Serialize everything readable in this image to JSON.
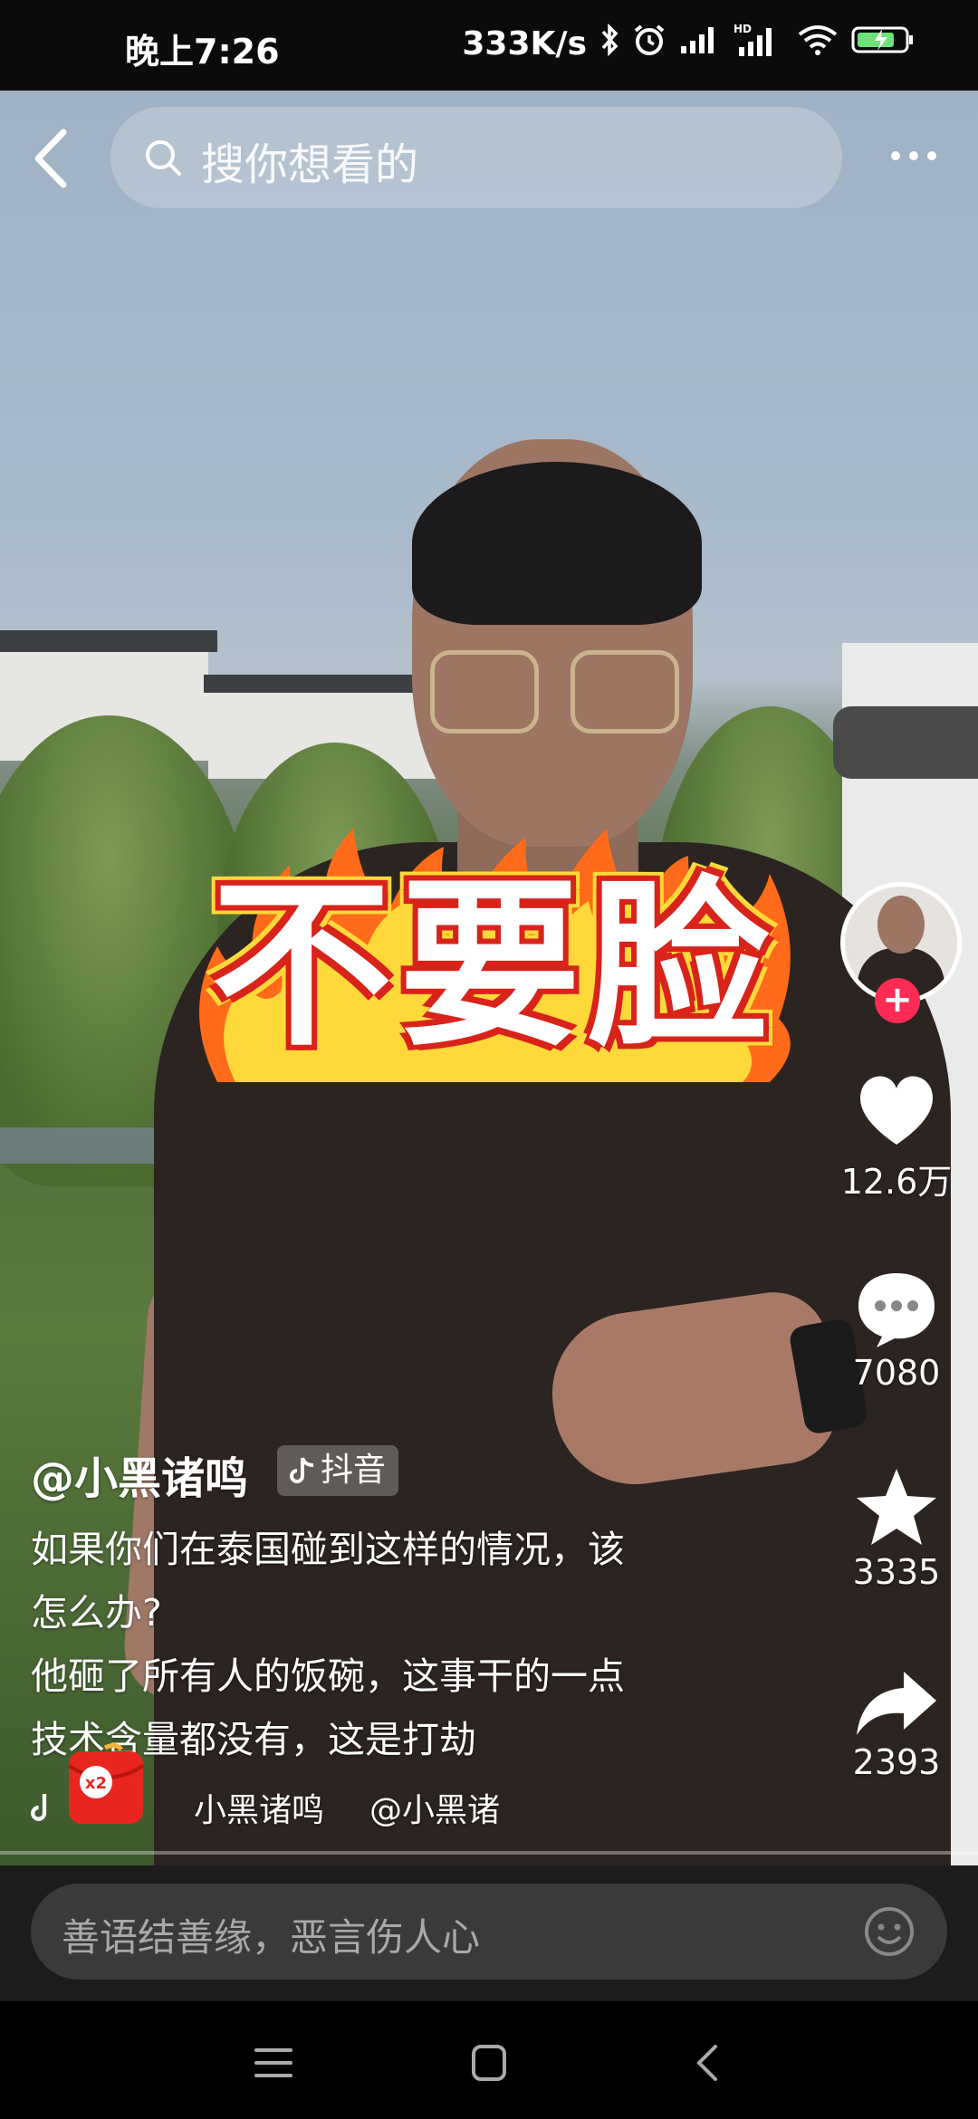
{
  "status_bar": {
    "time": "晚上7:26",
    "network_speed": "333K/s",
    "icons": [
      "bluetooth-icon",
      "alarm-icon",
      "signal-icon",
      "hd-signal-icon",
      "wifi-icon",
      "battery-charging-icon"
    ],
    "hd_label": "HD"
  },
  "top_bar": {
    "search_placeholder": "搜你想看的"
  },
  "video": {
    "sticker_text": "不要脸"
  },
  "sidebar": {
    "likes": "12.6万",
    "comments": "7080",
    "favorites": "3335",
    "shares": "2393"
  },
  "caption": {
    "author": "@小黑诸鸣",
    "tag": "抖音",
    "lines": [
      "如果你们在泰国碰到这样的情况，该",
      "怎么办?",
      "他砸了所有人的饭碗，这事干的一点",
      "技术含量都没有，这是打劫"
    ],
    "music_a": "小黑诸鸣",
    "music_b": "@小黑诸",
    "redpacket_label": "x2"
  },
  "comment_bar": {
    "placeholder": "善语结善缘，恶言伤人心"
  },
  "colors": {
    "accent": "#fe2c55",
    "sticker_red": "#d8231b",
    "sticker_yellow": "#ffd93a"
  }
}
